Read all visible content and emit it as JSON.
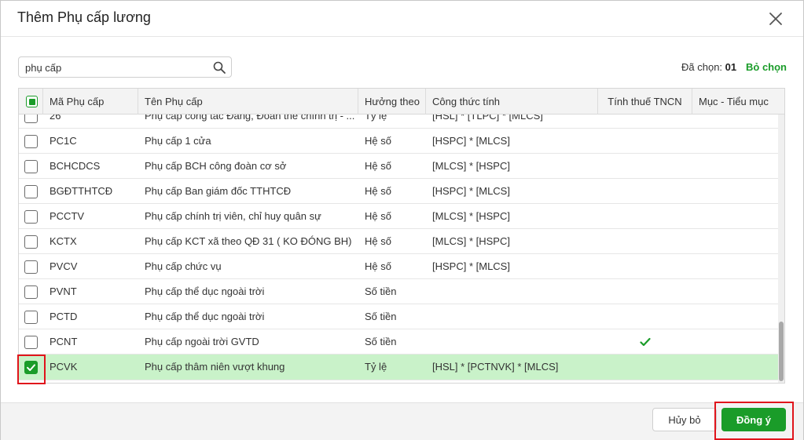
{
  "dialog": {
    "title": "Thêm Phụ cấp lương",
    "close_icon": "close-icon"
  },
  "search": {
    "value": "phụ cấp",
    "placeholder": "",
    "icon": "search-icon"
  },
  "selection": {
    "label": "Đã chọn:",
    "count": "01",
    "deselect_label": "Bỏ chọn"
  },
  "table": {
    "columns": [
      "Mã Phụ cấp",
      "Tên Phụ cấp",
      "Hưởng theo",
      "Công thức tính",
      "Tính thuế TNCN",
      "Mục - Tiểu mục"
    ],
    "rows": [
      {
        "code": "26",
        "name": "Phụ cấp công tác Đảng, Đoàn thể chính trị - ...",
        "type": "Tỷ lệ",
        "formula": "[HSL] * [TLPC] * [MLCS]",
        "tax": false,
        "checked": false
      },
      {
        "code": "PC1C",
        "name": "Phụ cấp 1 cửa",
        "type": "Hệ số",
        "formula": "[HSPC] * [MLCS]",
        "tax": false,
        "checked": false
      },
      {
        "code": "BCHCDCS",
        "name": "Phụ cấp BCH công đoàn cơ sở",
        "type": "Hệ số",
        "formula": "[MLCS] * [HSPC]",
        "tax": false,
        "checked": false
      },
      {
        "code": "BGĐTTHTCĐ",
        "name": "Phụ cấp Ban giám đốc TTHTCĐ",
        "type": "Hệ số",
        "formula": "[HSPC] * [MLCS]",
        "tax": false,
        "checked": false
      },
      {
        "code": "PCCTV",
        "name": "Phụ cấp chính trị viên, chỉ huy quân sự",
        "type": "Hệ số",
        "formula": "[MLCS] * [HSPC]",
        "tax": false,
        "checked": false
      },
      {
        "code": "KCTX",
        "name": "Phụ cấp KCT xã theo QĐ 31 ( KO ĐÓNG BH)",
        "type": "Hệ số",
        "formula": "[MLCS] * [HSPC]",
        "tax": false,
        "checked": false
      },
      {
        "code": "PVCV",
        "name": "Phụ cấp chức vụ",
        "type": "Hệ số",
        "formula": "[HSPC] * [MLCS]",
        "tax": false,
        "checked": false
      },
      {
        "code": "PVNT",
        "name": "Phụ cấp thể dục ngoài trời",
        "type": "Số tiền",
        "formula": "",
        "tax": false,
        "checked": false
      },
      {
        "code": "PCTD",
        "name": "Phụ cấp thể dục ngoài trời",
        "type": "Số tiền",
        "formula": "",
        "tax": false,
        "checked": false
      },
      {
        "code": "PCNT",
        "name": "Phụ cấp ngoài trời GVTD",
        "type": "Số tiền",
        "formula": "",
        "tax": true,
        "checked": false
      },
      {
        "code": "PCVK",
        "name": "Phụ cấp thâm niên vượt khung",
        "type": "Tỷ lệ",
        "formula": "[HSL] * [PCTNVK] * [MLCS]",
        "tax": false,
        "checked": true
      }
    ]
  },
  "footer": {
    "cancel_label": "Hủy bỏ",
    "ok_label": "Đồng ý"
  },
  "colors": {
    "accent": "#1a9c29",
    "selected_row": "#c9f2c9",
    "highlight": "#e0141b"
  }
}
